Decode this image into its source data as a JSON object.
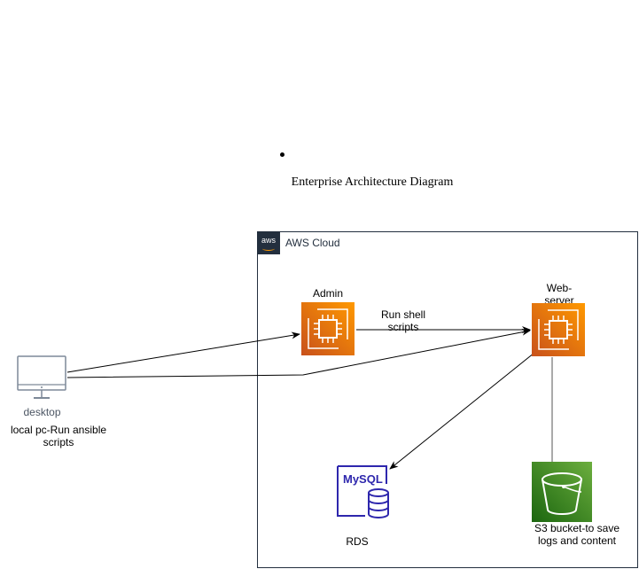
{
  "page": {
    "title": "Enterprise Architecture Diagram"
  },
  "cloud": {
    "label": "AWS Cloud",
    "logo_text": "aws"
  },
  "nodes": {
    "desktop": {
      "name": "desktop",
      "caption": "local pc-Run ansible scripts"
    },
    "admin": {
      "label": "Admin"
    },
    "webserver": {
      "label": "Web-server"
    },
    "rds": {
      "label": "RDS",
      "badge": "MySQL"
    },
    "s3": {
      "label": "S3 bucket-to save logs and content"
    }
  },
  "edges": {
    "admin_to_web": {
      "label": "Run shell scripts"
    }
  },
  "icons": {
    "desktop": "desktop-monitor-icon",
    "admin": "ec2-instance-icon",
    "webserver": "ec2-instance-icon",
    "rds": "mysql-database-icon",
    "s3": "s3-bucket-icon"
  },
  "colors": {
    "ec2_gradient": [
      "#C8511B",
      "#FF9900"
    ],
    "s3_gradient": [
      "#1B660F",
      "#6CAE3E"
    ],
    "mysql": "#2E27AD",
    "aws_dark": "#232F3E"
  }
}
